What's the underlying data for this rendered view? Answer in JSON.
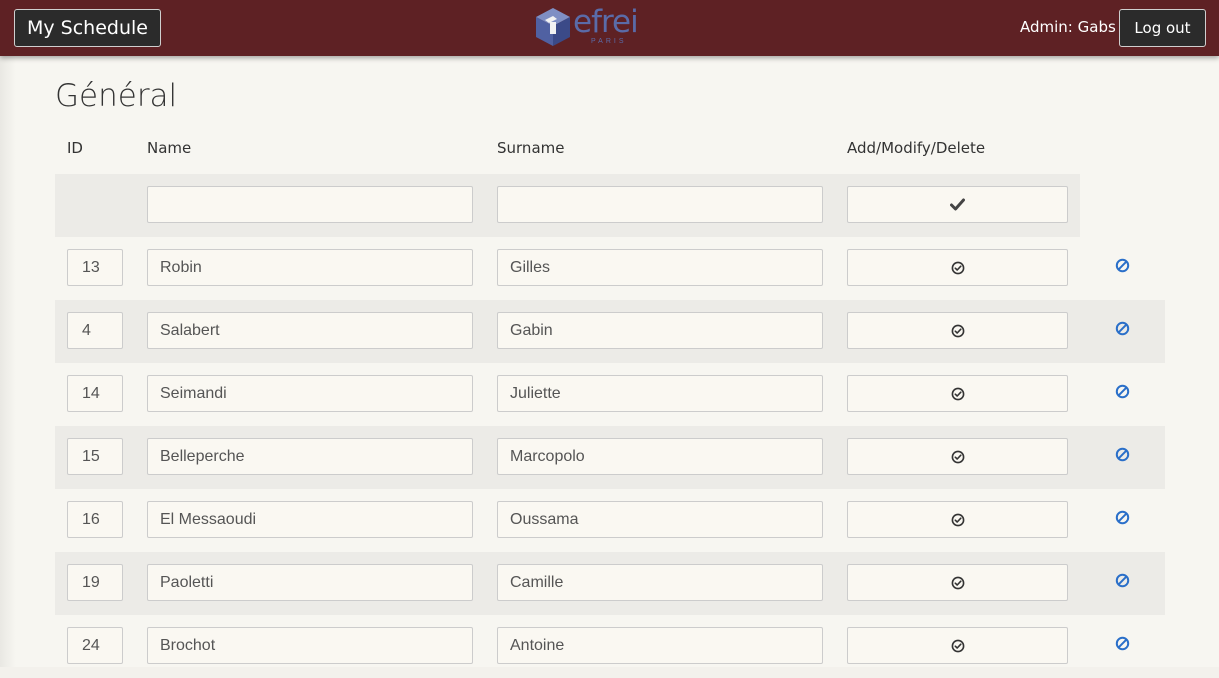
{
  "navbar": {
    "brand": "My Schedule",
    "logo_text": "efrei",
    "logo_subtext": "PARIS",
    "admin_label": "Admin: Gabs",
    "logout_label": "Log out",
    "bg_color": "#5e2124"
  },
  "page": {
    "title": "Général"
  },
  "table": {
    "headers": {
      "id": "ID",
      "name": "Name",
      "surname": "Surname",
      "actions": "Add/Modify/Delete"
    },
    "new_row": {
      "name": "",
      "surname": "",
      "action_icon": "check-icon"
    },
    "rows": [
      {
        "id": "13",
        "name": "Robin",
        "surname": "Gilles"
      },
      {
        "id": "4",
        "name": "Salabert",
        "surname": "Gabin"
      },
      {
        "id": "14",
        "name": "Seimandi",
        "surname": "Juliette"
      },
      {
        "id": "15",
        "name": "Belleperche",
        "surname": "Marcopolo"
      },
      {
        "id": "16",
        "name": "El Messaoudi",
        "surname": "Oussama"
      },
      {
        "id": "19",
        "name": "Paoletti",
        "surname": "Camille"
      },
      {
        "id": "24",
        "name": "Brochot",
        "surname": "Antoine"
      }
    ],
    "row_action_icon": "check-circle-icon",
    "row_delete_icon": "ban-icon",
    "delete_icon_color": "#2a6fc9"
  }
}
